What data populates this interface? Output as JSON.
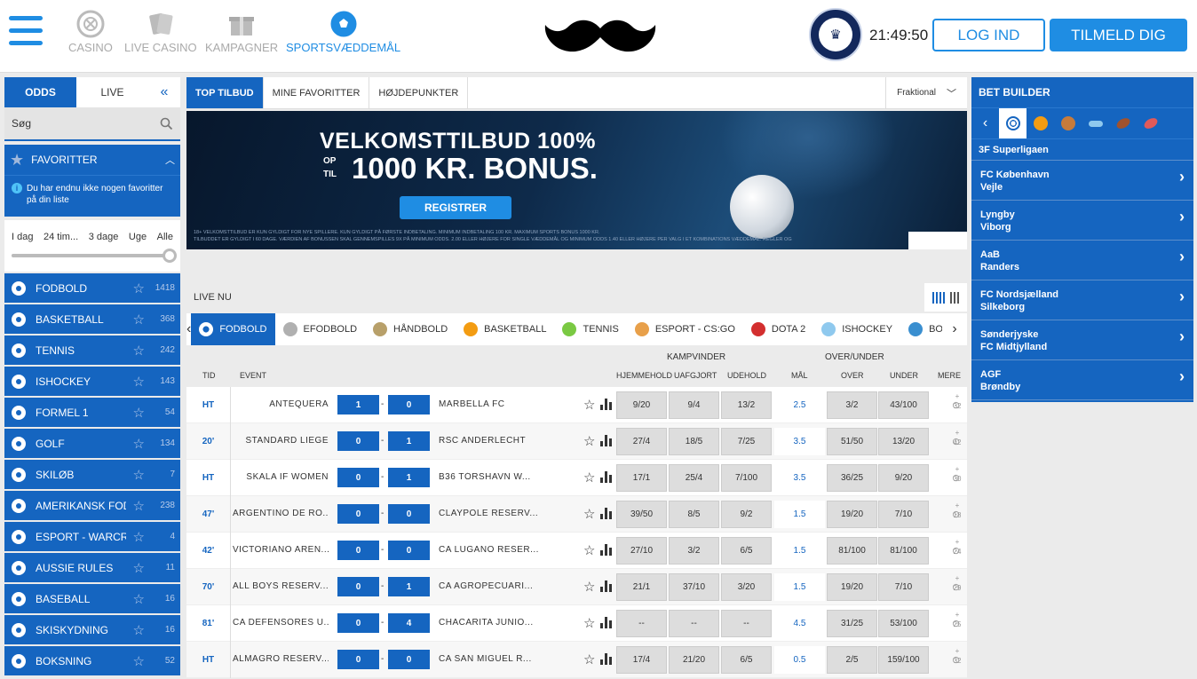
{
  "header": {
    "nav": [
      {
        "label": "CASINO",
        "icon": "casino-chip-icon",
        "active": false
      },
      {
        "label": "LIVE CASINO",
        "icon": "cards-icon",
        "active": false
      },
      {
        "label": "KAMPAGNER",
        "icon": "gift-icon",
        "active": false
      },
      {
        "label": "SPORTSVÆDDEMÅL",
        "icon": "football-icon",
        "active": true
      }
    ],
    "clock": "21:49:50",
    "login_label": "LOG IND",
    "signup_label": "TILMELD DIG",
    "accent": "#1f8de3"
  },
  "left": {
    "tabs": {
      "odds": "ODDS",
      "live": "LIVE",
      "collapse": "«"
    },
    "search_label": "Søg",
    "favorites": {
      "title": "FAVORITTER",
      "note": "Du har endnu ikke nogen favoritter på din liste"
    },
    "time_filter": [
      "I dag",
      "24 tim...",
      "3 dage",
      "Uge",
      "Alle"
    ],
    "time_filter_selected": 1.0,
    "sports": [
      {
        "name": "FODBOLD",
        "count": "1418",
        "icon": "football-icon"
      },
      {
        "name": "BASKETBALL",
        "count": "368",
        "icon": "basketball-icon"
      },
      {
        "name": "TENNIS",
        "count": "242",
        "icon": "tennis-icon"
      },
      {
        "name": "ISHOCKEY",
        "count": "143",
        "icon": "puck-icon"
      },
      {
        "name": "FORMEL 1",
        "count": "54",
        "icon": "checkered-flag-icon"
      },
      {
        "name": "GOLF",
        "count": "134",
        "icon": "golf-icon"
      },
      {
        "name": "SKILØB",
        "count": "7",
        "icon": "snowflake-icon"
      },
      {
        "name": "AMERIKANSK FODB...",
        "count": "238",
        "icon": "american-football-icon"
      },
      {
        "name": "ESPORT - WARCRAF...",
        "count": "4",
        "icon": "esport-icon"
      },
      {
        "name": "AUSSIE RULES",
        "count": "11",
        "icon": "aussie-rules-icon"
      },
      {
        "name": "BASEBALL",
        "count": "16",
        "icon": "baseball-icon"
      },
      {
        "name": "SKISKYDNING",
        "count": "16",
        "icon": "biathlon-icon"
      },
      {
        "name": "BOKSNING",
        "count": "52",
        "icon": "boxing-icon"
      }
    ]
  },
  "center": {
    "tabs": [
      "TOP TILBUD",
      "MINE FAVORITTER",
      "HØJDEPUNKTER"
    ],
    "format": "Fraktional",
    "banner": {
      "line1": "VELKOMSTTILBUD 100%",
      "op": "OP",
      "til": "TIL",
      "line2": "1000 KR. BONUS.",
      "cta": "REGISTRER",
      "fine1": "18+ VELKOMSTTILBUD ER KUN GYLDIGT FOR NYE SPILLERE. KUN GYLDIGT PÅ FØRSTE INDBETALING. MINIMUM INDBETALING 100 KR. MAXIMUM SPORTS BONUS 1000 KR.",
      "fine2": "TILBUDDET ER GYLDIGT I 60 DAGE. VÆRDIEN AF BONUSSEN SKAL GENNEMSPILLES 9X PÅ MINIMUM ODDS. 2.00 ELLER HØJERE FOR SINGLE VÆDDEMÅL OG MINIMUM ODDS 1.40 ELLER HØJERE PER VALG I ET KOMBINATIONS VÆDDEMÅL. REGLER OG"
    },
    "live_title": "LIVE NU",
    "live_sports": [
      {
        "label": "FODBOLD",
        "color": "#ffffff"
      },
      {
        "label": "EFODBOLD",
        "color": "#b0b0b0"
      },
      {
        "label": "HÅNDBOLD",
        "color": "#b8a06a"
      },
      {
        "label": "BASKETBALL",
        "color": "#f39c12"
      },
      {
        "label": "TENNIS",
        "color": "#7ac943"
      },
      {
        "label": "ESPORT - CS:GO",
        "color": "#e8a04a"
      },
      {
        "label": "DOTA 2",
        "color": "#d32f2f"
      },
      {
        "label": "ISHOCKEY",
        "color": "#8fc9ee"
      },
      {
        "label": "BORDTENN",
        "color": "#3a8fd0"
      }
    ],
    "columns": {
      "tid": "TID",
      "event": "EVENT",
      "kampvinder": "KAMPVINDER",
      "hjemmehold": "HJEMMEHOLD",
      "uafgjort": "UAFGJORT",
      "udehold": "UDEHOLD",
      "mal": "MÅL",
      "overunder": "OVER/UNDER",
      "over": "OVER",
      "under": "UNDER",
      "mere": "MERE"
    },
    "matches": [
      {
        "time": "HT",
        "home": "ANTEQUERA",
        "hs": "1",
        "as": "0",
        "away": "MARBELLA FC",
        "o1": "9/20",
        "ox": "9/4",
        "o2": "13/2",
        "goal": "2.5",
        "over": "3/2",
        "under": "43/100",
        "more": "+ 32"
      },
      {
        "time": "20'",
        "home": "STANDARD LIEGE",
        "hs": "0",
        "as": "1",
        "away": "RSC ANDERLECHT",
        "o1": "27/4",
        "ox": "18/5",
        "o2": "7/25",
        "goal": "3.5",
        "over": "51/50",
        "under": "13/20",
        "more": "+ 42"
      },
      {
        "time": "HT",
        "home": "SKALA IF WOMEN",
        "hs": "0",
        "as": "1",
        "away": "B36 TÓRSHAVN W...",
        "o1": "17/1",
        "ox": "25/4",
        "o2": "7/100",
        "goal": "3.5",
        "over": "36/25",
        "under": "9/20",
        "more": "+ 30"
      },
      {
        "time": "47'",
        "home": "ARGENTINO DE RO...",
        "hs": "0",
        "as": "0",
        "away": "CLAYPOLE RESERV...",
        "o1": "39/50",
        "ox": "8/5",
        "o2": "9/2",
        "goal": "1.5",
        "over": "19/20",
        "under": "7/10",
        "more": "+ 18"
      },
      {
        "time": "42'",
        "home": "VICTORIANO AREN...",
        "hs": "0",
        "as": "0",
        "away": "CA LUGANO RESER...",
        "o1": "27/10",
        "ox": "3/2",
        "o2": "6/5",
        "goal": "1.5",
        "over": "81/100",
        "under": "81/100",
        "more": "+ 24"
      },
      {
        "time": "70'",
        "home": "ALL BOYS RESERV...",
        "hs": "0",
        "as": "1",
        "away": "CA AGROPECUARI...",
        "o1": "21/1",
        "ox": "37/10",
        "o2": "3/20",
        "goal": "1.5",
        "over": "19/20",
        "under": "7/10",
        "more": "+ 29"
      },
      {
        "time": "81'",
        "home": "CA DEFENSORES U...",
        "hs": "0",
        "as": "4",
        "away": "CHACARITA JUNIO...",
        "o1": "--",
        "ox": "--",
        "o2": "--",
        "goal": "4.5",
        "over": "31/25",
        "under": "53/100",
        "more": "+ 25"
      },
      {
        "time": "HT",
        "home": "ALMAGRO RESERV...",
        "hs": "0",
        "as": "0",
        "away": "CA SAN MIGUEL R...",
        "o1": "17/4",
        "ox": "21/20",
        "o2": "6/5",
        "goal": "0.5",
        "over": "2/5",
        "under": "159/100",
        "more": "+ 32"
      }
    ]
  },
  "right": {
    "title": "BET BUILDER",
    "league": "3F Superligaen",
    "matches": [
      {
        "home": "FC København",
        "away": "Vejle"
      },
      {
        "home": "Lyngby",
        "away": "Viborg"
      },
      {
        "home": "AaB",
        "away": "Randers"
      },
      {
        "home": "FC Nordsjælland",
        "away": "Silkeborg"
      },
      {
        "home": "Sønderjyske",
        "away": "FC Midtjylland"
      },
      {
        "home": "AGF",
        "away": "Brøndby"
      }
    ]
  }
}
